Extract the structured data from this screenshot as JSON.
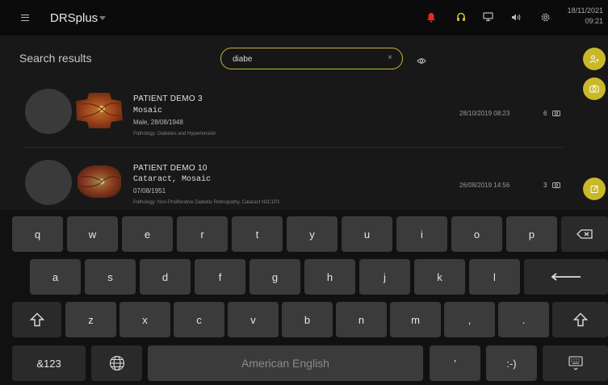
{
  "topbar": {
    "title": "DRSplus",
    "icons": [
      "menu-icon",
      "bell-icon",
      "headset-icon",
      "monitor-icon",
      "volume-icon",
      "gear-icon"
    ],
    "date": "18/11/2021",
    "time": "09:21",
    "alert_color": "#e5281d",
    "accent_color": "#d4c12a"
  },
  "search": {
    "label": "Search results",
    "value": "diabe",
    "clear": "×"
  },
  "patients": [
    {
      "name": "PATIENT DEMO 3",
      "tags": "Mosaic",
      "info": "Male, 28/08/1948",
      "pathology": "Pathology: Diabetes and Hypertension",
      "date": "28/10/2019 08:23",
      "count": "6"
    },
    {
      "name": "PATIENT DEMO 10",
      "tags": "Cataract, Mosaic",
      "info": "07/08/1951",
      "pathology": "Pathology: Non-Proliferative Diabetic Retinopathy, Cataract N3C1P1",
      "date": "26/08/2019 14:56",
      "count": "3"
    }
  ],
  "keyboard": {
    "row1": [
      "q",
      "w",
      "e",
      "r",
      "t",
      "y",
      "u",
      "i",
      "o",
      "p"
    ],
    "row2": [
      "a",
      "s",
      "d",
      "f",
      "g",
      "h",
      "j",
      "k",
      "l"
    ],
    "row3": [
      "z",
      "x",
      "c",
      "v",
      "b",
      "n",
      "m",
      ",",
      "."
    ],
    "symbols": "&123",
    "space": "American English",
    "apostrophe": "'",
    "smiley": ":-)"
  }
}
